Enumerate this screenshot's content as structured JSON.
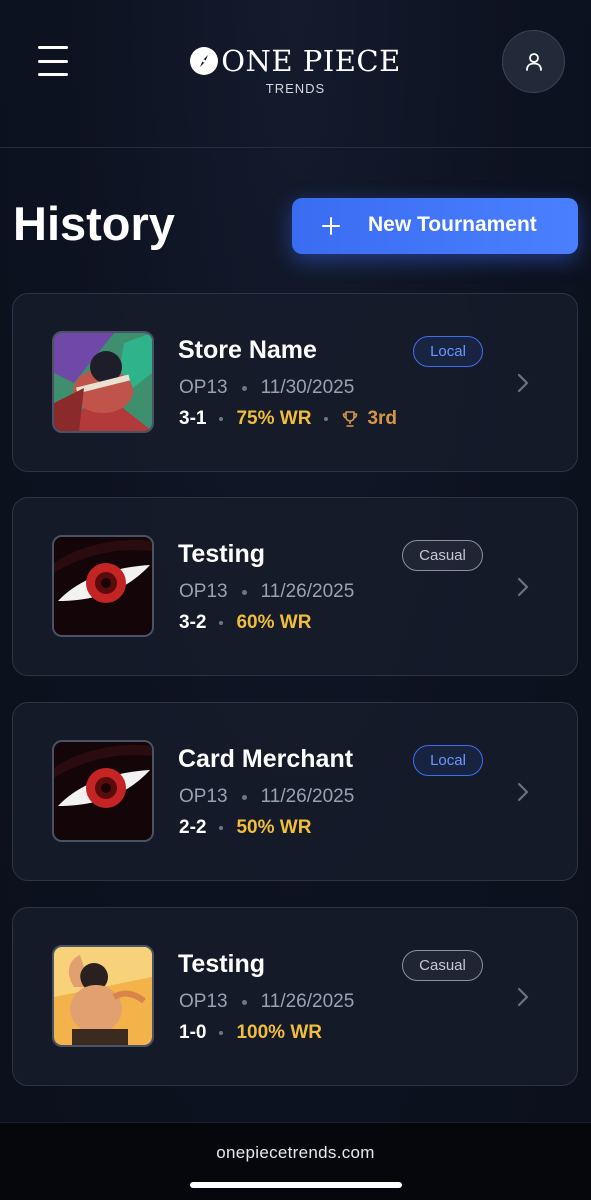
{
  "header": {
    "brand_name": "ONE PIECE",
    "brand_sub": "TRENDS",
    "menu_icon": "hamburger-menu-icon",
    "profile_icon": "user-icon"
  },
  "main": {
    "title": "History",
    "new_button_label": "New Tournament"
  },
  "tournaments": [
    {
      "name": "Store Name",
      "type": "Local",
      "set": "OP13",
      "date": "11/30/2025",
      "record": "3-1",
      "win_rate": "75% WR",
      "placement": "3rd"
    },
    {
      "name": "Testing",
      "type": "Casual",
      "set": "OP13",
      "date": "11/26/2025",
      "record": "3-2",
      "win_rate": "60% WR"
    },
    {
      "name": "Card Merchant",
      "type": "Local",
      "set": "OP13",
      "date": "11/26/2025",
      "record": "2-2",
      "win_rate": "50% WR"
    },
    {
      "name": "Testing",
      "type": "Casual",
      "set": "OP13",
      "date": "11/26/2025",
      "record": "1-0",
      "win_rate": "100% WR"
    }
  ],
  "footer": {
    "url": "onepiecetrends.com"
  },
  "colors": {
    "background": "#0d1220",
    "accent": "#3a6cf2",
    "win_rate": "#f1bd3c",
    "placement": "#d6964a",
    "local_badge": "#6d95ff",
    "casual_badge": "#c5c9d2"
  }
}
